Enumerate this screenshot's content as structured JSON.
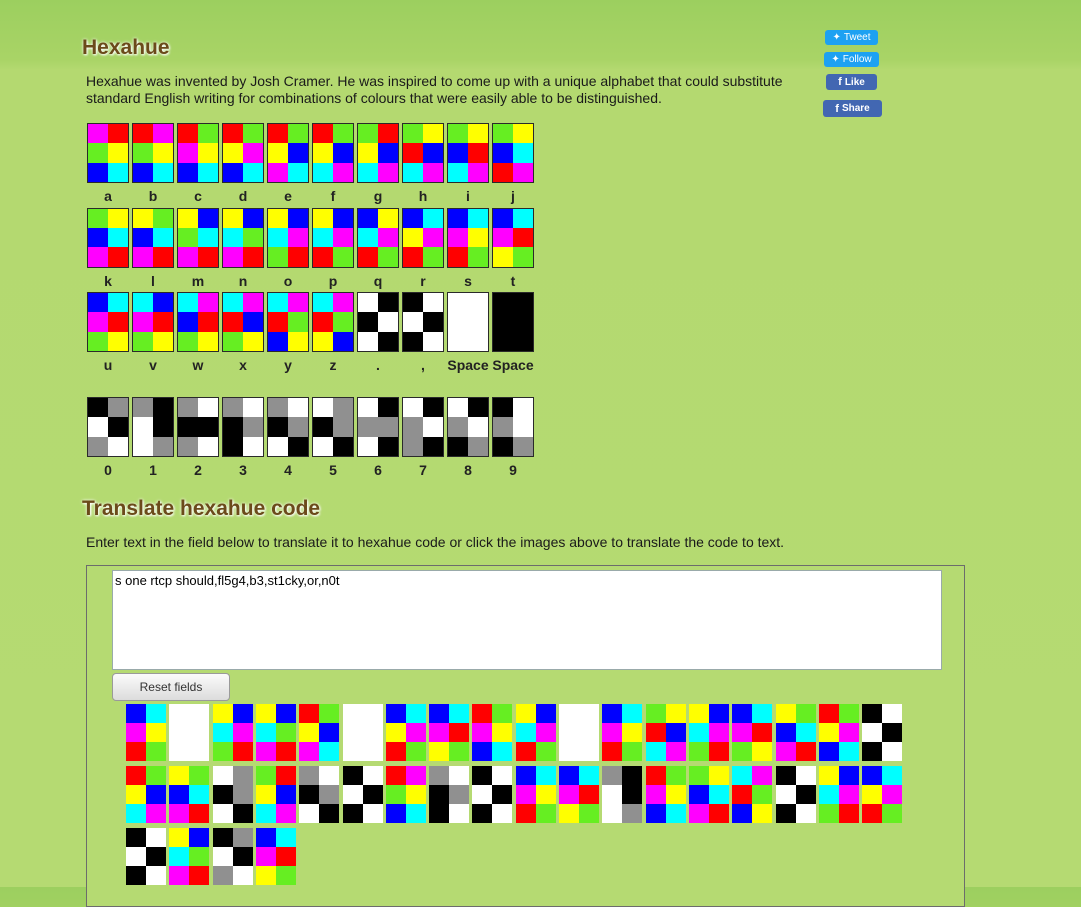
{
  "header": {
    "title": "Hexahue",
    "intro": "Hexahue was invented by Josh Cramer. He was inspired to come up with a unique alphabet that could substitute standard English writing for combinations of colours that were easily able to be distinguished."
  },
  "social": {
    "tweet": "Tweet",
    "follow": "Follow",
    "like": "Like",
    "share": "Share"
  },
  "palette": {
    "M": "#ff00ff",
    "R": "#ff0000",
    "G": "#66ee22",
    "Y": "#ffff00",
    "B": "#0000ff",
    "C": "#00ffff",
    "K": "#000000",
    "W": "#ffffff",
    "A": "#909090"
  },
  "alphabet": [
    {
      "label": "a",
      "code": "MRGYBC"
    },
    {
      "label": "b",
      "code": "RMGYBC"
    },
    {
      "label": "c",
      "code": "RGMYBC"
    },
    {
      "label": "d",
      "code": "RGYMBC"
    },
    {
      "label": "e",
      "code": "RGYBMC"
    },
    {
      "label": "f",
      "code": "RGYBCM"
    },
    {
      "label": "g",
      "code": "GRYBCM"
    },
    {
      "label": "h",
      "code": "GYRBCM"
    },
    {
      "label": "i",
      "code": "GYBRCM"
    },
    {
      "label": "j",
      "code": "GYBCRM"
    },
    {
      "label": "k",
      "code": "GYBCMR"
    },
    {
      "label": "l",
      "code": "YGBCMR"
    },
    {
      "label": "m",
      "code": "YBGCMR"
    },
    {
      "label": "n",
      "code": "YBCGMR"
    },
    {
      "label": "o",
      "code": "YBCMGR"
    },
    {
      "label": "p",
      "code": "YBCMRG"
    },
    {
      "label": "q",
      "code": "BYCMRG"
    },
    {
      "label": "r",
      "code": "BCYMRG"
    },
    {
      "label": "s",
      "code": "BCMYRG"
    },
    {
      "label": "t",
      "code": "BCMRYG"
    },
    {
      "label": "u",
      "code": "BCMRGY"
    },
    {
      "label": "v",
      "code": "CBMRGY"
    },
    {
      "label": "w",
      "code": "CMBRGY"
    },
    {
      "label": "x",
      "code": "CMRBGY"
    },
    {
      "label": "y",
      "code": "CMRGBY"
    },
    {
      "label": "z",
      "code": "CMRGYB"
    },
    {
      "label": ".",
      "code": "WKKWWK"
    },
    {
      "label": ",",
      "code": "KWWKKW"
    },
    {
      "label": "Space",
      "code": "WWWWWW"
    },
    {
      "label": "Space",
      "code": "KKKKKK"
    }
  ],
  "digits": [
    {
      "label": "0",
      "code": "KAWKAW"
    },
    {
      "label": "1",
      "code": "AKWKWA"
    },
    {
      "label": "2",
      "code": "AWKKAW"
    },
    {
      "label": "3",
      "code": "AWKAKW"
    },
    {
      "label": "4",
      "code": "AWKAWK"
    },
    {
      "label": "5",
      "code": "WAKAWK"
    },
    {
      "label": "6",
      "code": "WKAAWK"
    },
    {
      "label": "7",
      "code": "WKAWAK"
    },
    {
      "label": "8",
      "code": "WKAWKA"
    },
    {
      "label": "9",
      "code": "KWAWKA"
    }
  ],
  "translate": {
    "title": "Translate hexahue code",
    "instructions": "Enter text in the field below to translate it to hexahue code or click the images above to translate the code to text.",
    "input_value": "s one rtcp should,fl5g4,b3,st1cky,or,n0t",
    "reset_label": "Reset fields"
  }
}
